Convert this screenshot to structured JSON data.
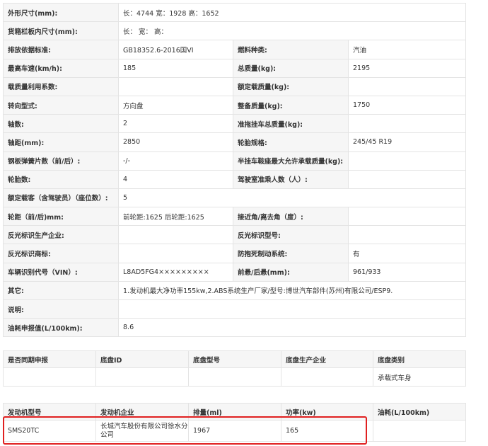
{
  "spec": {
    "overall_size_label": "外形尺寸(mm):",
    "overall_size_value": "长：4744 宽：1928 高：1652",
    "cargo_box_label": "货箱栏板内尺寸(mm):",
    "cargo_box_value": "长： 宽： 高：",
    "emission_label": "排放依据标准:",
    "emission_value": "GB18352.6-2016国VI",
    "fuel_label": "燃料种类:",
    "fuel_value": "汽油",
    "max_speed_label": "最高车速(km/h):",
    "max_speed_value": "185",
    "total_mass_label": "总质量(kg):",
    "total_mass_value": "2195",
    "load_util_label": "载质量利用系数:",
    "load_util_value": "",
    "rated_load_label": "额定载质量(kg):",
    "rated_load_value": "",
    "steering_label": "转向型式:",
    "steering_value": "方向盘",
    "curb_mass_label": "整备质量(kg):",
    "curb_mass_value": "1750",
    "axles_label": "轴数:",
    "axles_value": "2",
    "trailer_mass_label": "准拖挂车总质量(kg):",
    "trailer_mass_value": "",
    "wheelbase_label": "轴距(mm):",
    "wheelbase_value": "2850",
    "tire_spec_label": "轮胎规格:",
    "tire_spec_value": "245/45 R19",
    "leaf_spring_label": "钢板弹簧片数（前/后）:",
    "leaf_spring_value": "-/-",
    "saddle_load_label": "半挂车鞍座最大允许承载质量(kg):",
    "saddle_load_value": "",
    "tires_label": "轮胎数:",
    "tires_value": "4",
    "cab_pass_label": "驾驶室准乘人数（人）:",
    "cab_pass_value": "",
    "seats_label": "额定载客（含驾驶员）（座位数）:",
    "seats_value": "5",
    "track_label": "轮距（前/后)mm:",
    "track_value": "前轮距:1625 后轮距:1625",
    "approach_label": "接近角/离去角（度）:",
    "approach_value": "",
    "refl_maker_label": "反光标识生产企业:",
    "refl_maker_value": "",
    "refl_model_label": "反光标识型号:",
    "refl_model_value": "",
    "refl_brand_label": "反光标识商标:",
    "refl_brand_value": "",
    "abs_label": "防抱死制动系统:",
    "abs_value": "有",
    "vin_label": "车辆识别代号（VIN）:",
    "vin_value": "L8AD5FG4×××××××××",
    "overhang_label": "前悬/后悬(mm):",
    "overhang_value": "961/933",
    "other_label": "其它:",
    "other_value": "1.发动机最大净功率155kw,2.ABS系统生产厂家/型号:博世汽车部件(苏州)有限公司/ESP9.",
    "note_label": "说明:",
    "note_value": "",
    "fuel_cons_label": "油耗申报值(L/100km):",
    "fuel_cons_value": "8.6"
  },
  "chassis": {
    "headers": [
      "是否同期申报",
      "底盘ID",
      "底盘型号",
      "底盘生产企业",
      "底盘类别"
    ],
    "row": [
      "",
      "",
      "",
      "",
      "承载式车身"
    ]
  },
  "engine": {
    "headers": [
      "发动机型号",
      "发动机企业",
      "排量(ml)",
      "功率(kw)",
      "油耗(L/100km)"
    ],
    "row": [
      "SMS20TC",
      "长城汽车股份有限公司徐水分公司",
      "1967",
      "165",
      ""
    ]
  },
  "highlight_color": "#e02020"
}
